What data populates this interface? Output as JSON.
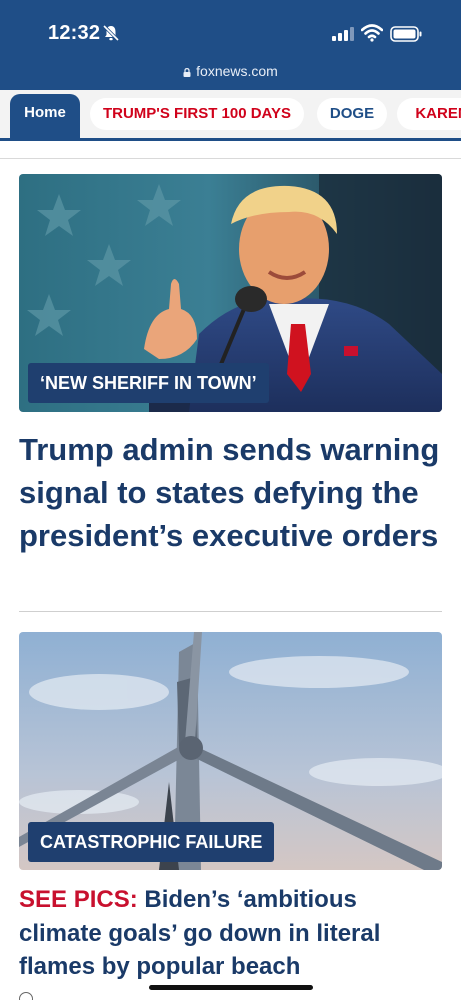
{
  "status_bar": {
    "time": "12:32",
    "icons": [
      "bell-slash-icon",
      "cellular-signal-icon",
      "wifi-icon",
      "battery-icon"
    ]
  },
  "browser": {
    "url": "foxnews.com",
    "lock_icon": "lock-icon"
  },
  "nav": {
    "tabs": [
      {
        "label": "Home",
        "active": true
      },
      {
        "label": "TRUMP'S FIRST 100 DAYS",
        "color": "#d0021b"
      },
      {
        "label": "DOGE",
        "color": "#1f4e87"
      },
      {
        "label": "KAREN",
        "color": "#d0021b"
      }
    ]
  },
  "stories": [
    {
      "kicker": "‘NEW SHERIFF IN TOWN’",
      "headline": "Trump admin sends warning signal to states defying the president’s executive orders"
    },
    {
      "kicker": "CATASTROPHIC FAILURE",
      "headline_prefix": "SEE PICS:",
      "headline": " Biden’s ‘ambitious climate goals’ go down in literal flames by popular beach"
    }
  ],
  "colors": {
    "brand_blue": "#1f4e87",
    "headline_blue": "#1a3a68",
    "accent_red": "#c8102e"
  }
}
